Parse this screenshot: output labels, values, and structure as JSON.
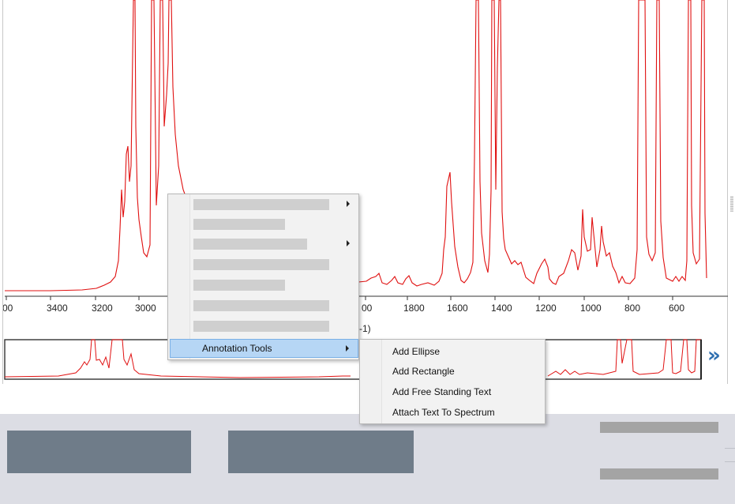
{
  "colors": {
    "spectrum": "#e01010",
    "menu_highlight": "#b6d6f5",
    "chevron": "#2e6fb0",
    "bottom_panel": "#dcdde4",
    "gray_button": "#6f7c89"
  },
  "axis": {
    "ticks": [
      "00",
      "3400",
      "3200",
      "3000",
      "00",
      "1800",
      "1600",
      "1400",
      "1200",
      "1000",
      "800",
      "600"
    ],
    "unit_fragment": "-1)"
  },
  "context_menu": {
    "items": [
      {
        "type": "redacted",
        "has_submenu": true
      },
      {
        "type": "redacted",
        "has_submenu": false
      },
      {
        "type": "redacted",
        "has_submenu": true
      },
      {
        "type": "redacted",
        "has_submenu": false
      },
      {
        "type": "redacted",
        "has_submenu": false
      },
      {
        "type": "redacted",
        "has_submenu": false
      },
      {
        "type": "redacted",
        "has_submenu": false
      },
      {
        "type": "label",
        "label": "Annotation Tools",
        "has_submenu": true,
        "highlighted": true
      }
    ]
  },
  "annotation_submenu": {
    "items": [
      "Add Ellipse",
      "Add Rectangle",
      "Add Free Standing Text",
      "Attach Text To Spectrum"
    ]
  },
  "navigator": {
    "scroll_glyph": "»"
  },
  "icons": {
    "scroll_right": "chevron-double-right-icon",
    "submenu": "submenu-arrow-icon",
    "splitter": "splitter-grip-icon"
  }
}
